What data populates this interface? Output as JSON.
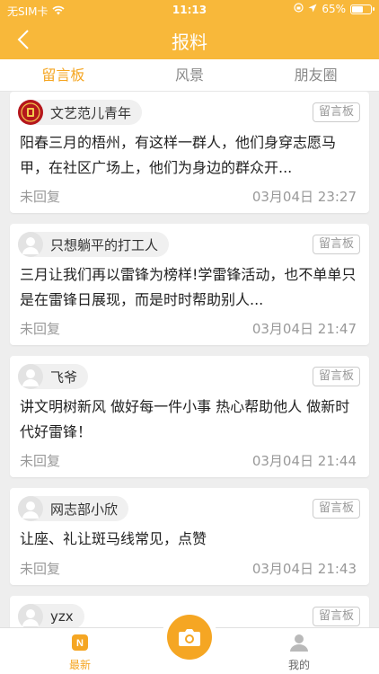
{
  "status_bar": {
    "carrier": "无SIM卡",
    "time": "11:13",
    "battery_percent": "65%",
    "battery_level": 0.65
  },
  "nav": {
    "title": "报料"
  },
  "tabs": [
    {
      "label": "留言板",
      "active": true
    },
    {
      "label": "风景",
      "active": false
    },
    {
      "label": "朋友圈",
      "active": false
    }
  ],
  "posts": [
    {
      "user": "文艺范儿青年",
      "tag": "留言板",
      "content": "阳春三月的梧州，有这样一群人，他们身穿志愿马甲，在社区广场上，他们为身边的群众开...",
      "status": "未回复",
      "time": "03月04日 23:27"
    },
    {
      "user": "只想躺平的打工人",
      "tag": "留言板",
      "content": "三月让我们再以雷锋为榜样!学雷锋活动，也不单单只是在雷锋日展现，而是时时帮助别人...",
      "status": "未回复",
      "time": "03月04日 21:47"
    },
    {
      "user": "飞爷",
      "tag": "留言板",
      "content": "讲文明树新风 做好每一件小事 热心帮助他人 做新时代好雷锋！",
      "status": "未回复",
      "time": "03月04日 21:44"
    },
    {
      "user": "网志部小欣",
      "tag": "留言板",
      "content": "让座、礼让斑马线常见，点赞",
      "status": "未回复",
      "time": "03月04日 21:43"
    },
    {
      "user": "yzx",
      "tag": "留言板",
      "content": "",
      "status": "",
      "time": ""
    }
  ],
  "bottom_nav": {
    "latest_label": "最新",
    "latest_badge": "N",
    "mine_label": "我的"
  },
  "colors": {
    "accent": "#f5a623",
    "header": "#f8b83a"
  }
}
